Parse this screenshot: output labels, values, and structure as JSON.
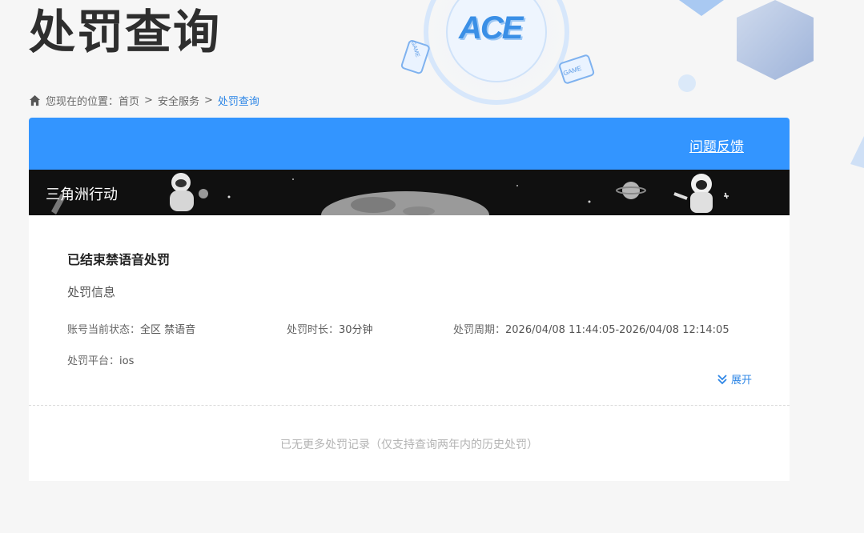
{
  "page": {
    "title": "处罚查询"
  },
  "breadcrumb": {
    "prefix": "您现在的位置：",
    "items": [
      "首页",
      "安全服务",
      "处罚查询"
    ],
    "separator": ">"
  },
  "header": {
    "feedback_label": "问题反馈"
  },
  "game": {
    "name": "三角洲行动"
  },
  "decor": {
    "logo_text": "ACE",
    "tag_text": "GAME"
  },
  "record": {
    "title": "已结束禁语音处罚",
    "section_label": "处罚信息",
    "fields": {
      "status_label": "账号当前状态：",
      "status_value": "全区 禁语音",
      "duration_label": "处罚时长：",
      "duration_value": "30分钟",
      "period_label": "处罚周期：",
      "period_value": "2026/04/08 11:44:05-2026/04/08 12:14:05",
      "platform_label": "处罚平台：",
      "platform_value": "ios"
    },
    "expand_label": "展开"
  },
  "footer": {
    "no_more_text": "已无更多处罚记录（仅支持查询两年内的历史处罚）"
  },
  "colors": {
    "accent": "#3395ff",
    "link": "#2d86e6",
    "banner_bg": "#101010"
  }
}
